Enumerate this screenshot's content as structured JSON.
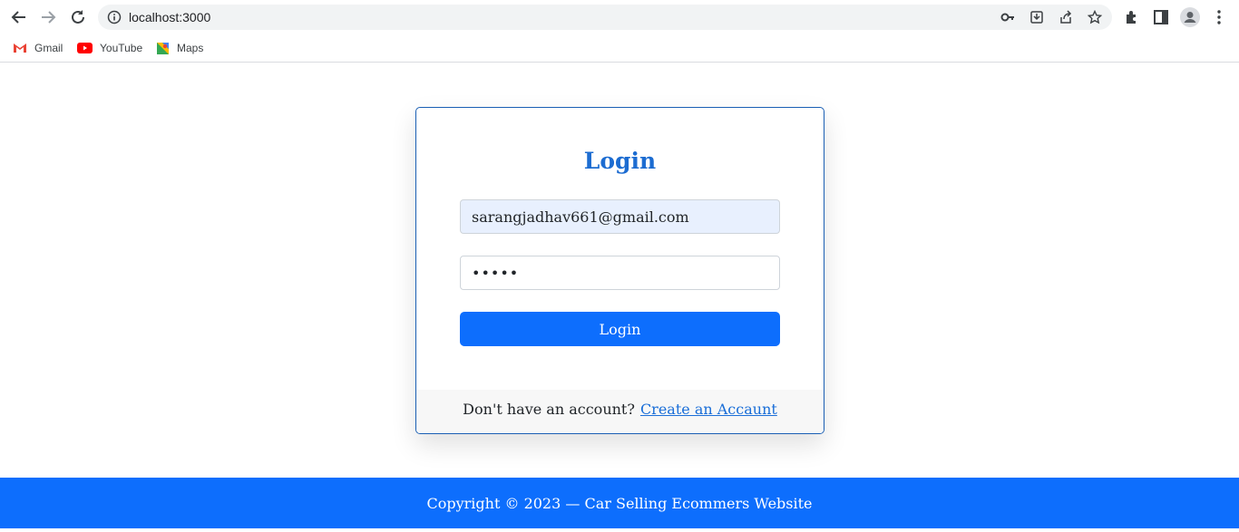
{
  "browser": {
    "url": "localhost:3000",
    "bookmarks": [
      {
        "label": "Gmail",
        "icon": "gmail-icon"
      },
      {
        "label": "YouTube",
        "icon": "youtube-icon"
      },
      {
        "label": "Maps",
        "icon": "maps-icon"
      }
    ]
  },
  "login": {
    "title": "Login",
    "email_value": "sarangjadhav661@gmail.com",
    "password_masked": "•••••",
    "button_label": "Login",
    "footer_text": "Don't have an account?",
    "signup_link": "Create an Accaunt"
  },
  "footer": {
    "copyright": "Copyright © 2023 — Car Selling Ecommers Website"
  },
  "colors": {
    "primary": "#0d6efd",
    "title": "#1c6cd1",
    "autofill": "#e8f0fe"
  }
}
